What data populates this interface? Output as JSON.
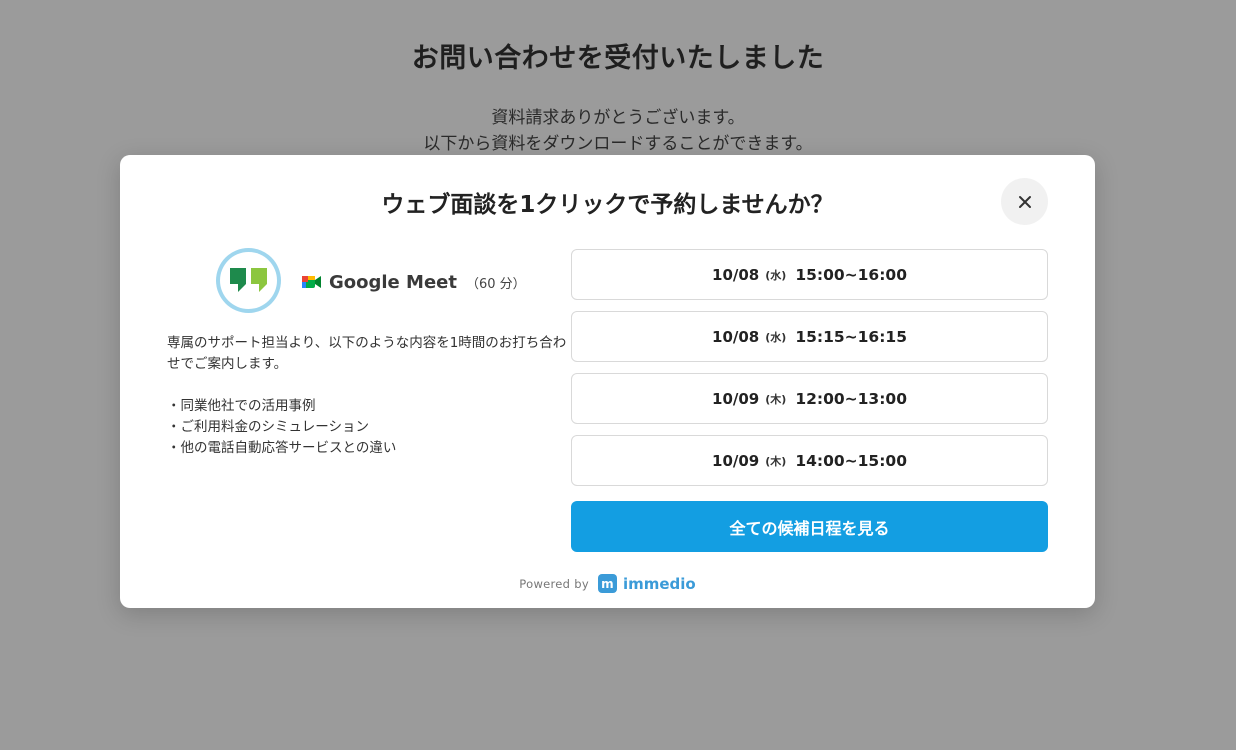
{
  "page": {
    "title": "お問い合わせを受付いたしました",
    "subtitle_line1": "資料請求ありがとうございます。",
    "subtitle_line2": "以下から資料をダウンロードすることができます。"
  },
  "modal": {
    "title": "ウェブ面談を1クリックで予約しませんか？",
    "close_icon": "close-icon",
    "meeting": {
      "platform": "Google Meet",
      "duration": "（60 分）"
    },
    "description": "専属のサポート担当より、以下のような内容を1時間のお打ち合わせでご案内します。",
    "bullets": [
      "・同業他社での活用事例",
      "・ご利用料金のシミュレーション",
      "・他の電話自動応答サービスとの違い"
    ],
    "slots": [
      {
        "date": "10/08",
        "dow": "(水)",
        "time": "15:00~16:00"
      },
      {
        "date": "10/08",
        "dow": "(水)",
        "time": "15:15~16:15"
      },
      {
        "date": "10/09",
        "dow": "(木)",
        "time": "12:00~13:00"
      },
      {
        "date": "10/09",
        "dow": "(木)",
        "time": "14:00~15:00"
      }
    ],
    "all_button_label": "全ての候補日程を見る",
    "powered_by": "Powered by",
    "brand_mark": "m",
    "brand_name": "immedio"
  },
  "colors": {
    "overlay": "#9b9b9b",
    "accent": "#139ee2",
    "brand": "#3b9bd8",
    "host_green": "#1e8a4c"
  }
}
